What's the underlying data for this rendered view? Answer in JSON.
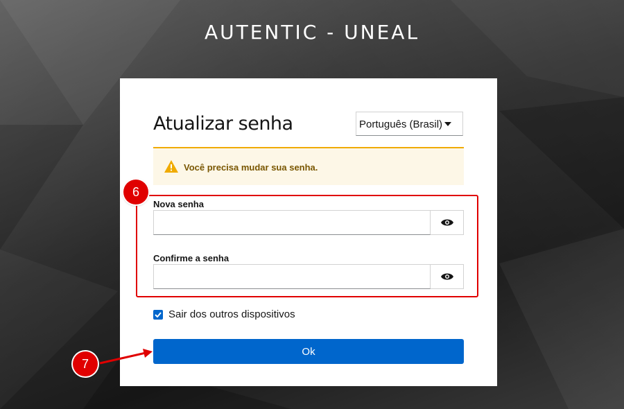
{
  "site": {
    "title": "AUTENTIC - UNEAL"
  },
  "form": {
    "heading": "Atualizar senha",
    "language_selected": "Português (Brasil)",
    "alert_message": "Você precisa mudar sua senha.",
    "new_password_label": "Nova senha",
    "new_password_value": "",
    "confirm_password_label": "Confirme a senha",
    "confirm_password_value": "",
    "logout_other_devices_label": "Sair dos outros dispositivos",
    "logout_other_devices_checked": true,
    "submit_label": "Ok"
  },
  "annotations": {
    "step_fields": "6",
    "step_button": "7"
  },
  "colors": {
    "primary": "#0066cc",
    "warning": "#f0ab00",
    "annotation": "#e00000"
  },
  "icons": {
    "show_password": "eye-icon",
    "alert": "warning-icon",
    "checkbox": "check-icon"
  }
}
